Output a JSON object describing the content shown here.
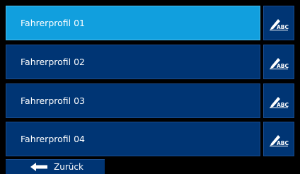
{
  "profiles": [
    {
      "label": "Fahrerprofil 01",
      "active": true
    },
    {
      "label": "Fahrerprofil 02",
      "active": false
    },
    {
      "label": "Fahrerprofil 03",
      "active": false
    },
    {
      "label": "Fahrerprofil 04",
      "active": false
    }
  ],
  "edit_icon": {
    "name": "edit-name-icon",
    "text": "ABC"
  },
  "back": {
    "label": "Zurück",
    "icon": "arrow-left-icon"
  },
  "colors": {
    "active": "#119fde",
    "inactive": "#003574",
    "background": "#000000"
  }
}
